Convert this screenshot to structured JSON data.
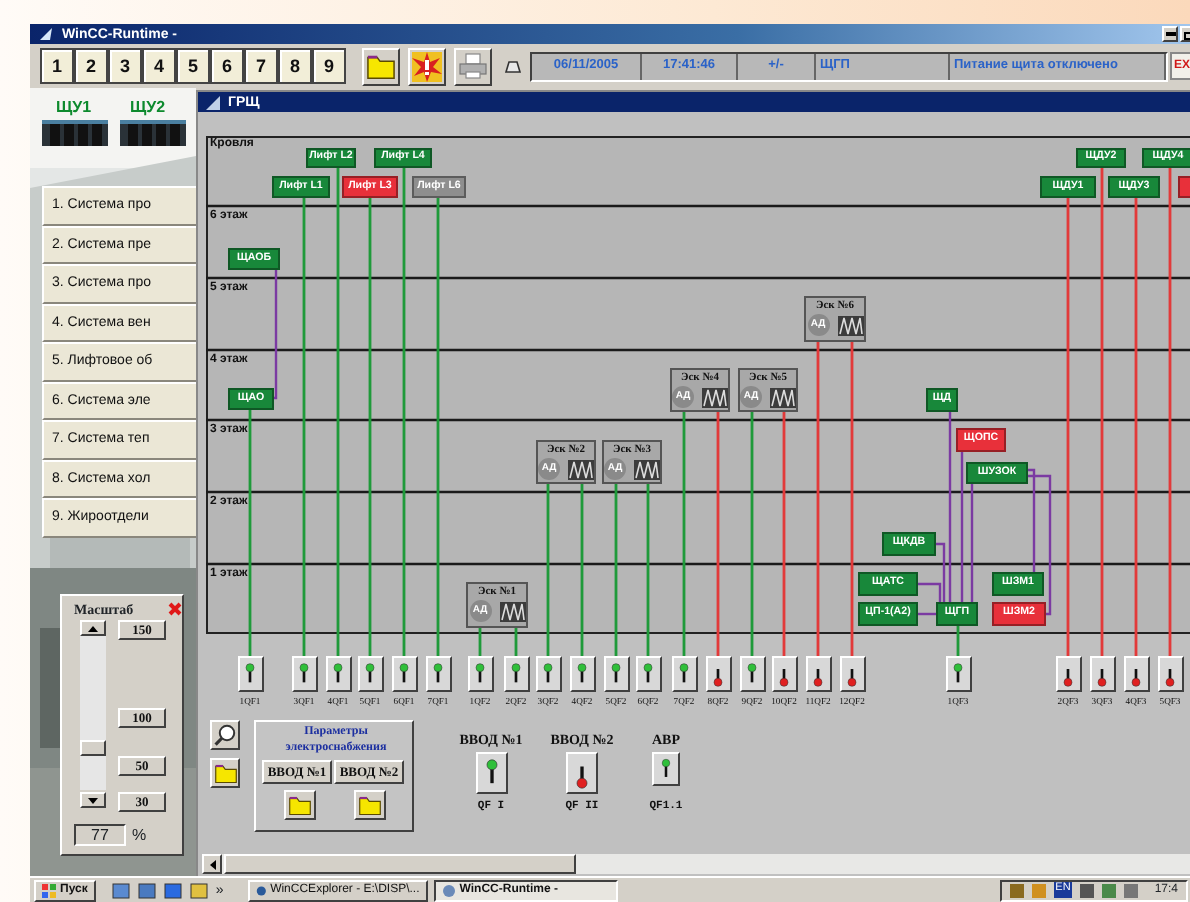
{
  "window": {
    "title": "WinCC-Runtime -"
  },
  "toolbar": {
    "screen_buttons": [
      "1",
      "2",
      "3",
      "4",
      "5",
      "6",
      "7",
      "8",
      "9"
    ],
    "date": "06/11/2005",
    "time": "17:41:46",
    "sign": "+/-",
    "panel": "ЩГП",
    "message": "Питание щита отключено",
    "exit": "EX"
  },
  "left_panel": {
    "cabinets": [
      "ЩУ1",
      "ЩУ2"
    ],
    "menu": [
      "1. Система про",
      "2. Система пре",
      "3. Система про",
      "4. Система вен",
      "5. Лифтовое об",
      "6. Система эле",
      "7. Система теп",
      "8. Система хол",
      "9. Жироотдели"
    ]
  },
  "scale_panel": {
    "title": "Масштаб",
    "presets": [
      "150",
      "100",
      "50",
      "30"
    ],
    "level": 0.25,
    "value": "77",
    "unit": "%"
  },
  "grsh_window": {
    "title": "ГРЩ",
    "floors": [
      "Кровля",
      "6 этаж",
      "5 этаж",
      "4 этаж",
      "3 этаж",
      "2 этаж",
      "1 этаж"
    ],
    "nodes": [
      {
        "kind": "panel",
        "label": "Лифт L2",
        "on": true,
        "disabled": false
      },
      {
        "kind": "panel",
        "label": "Лифт L4",
        "on": true,
        "disabled": false
      },
      {
        "kind": "panel",
        "label": "ЩДУ2",
        "on": true,
        "disabled": false
      },
      {
        "kind": "panel",
        "label": "ЩДУ4",
        "on": true,
        "disabled": false
      },
      {
        "kind": "panel",
        "label": "Лифт L1",
        "on": true,
        "disabled": false
      },
      {
        "kind": "panel",
        "label": "Лифт L3",
        "on": false,
        "disabled": false
      },
      {
        "kind": "panel",
        "label": "Лифт L6",
        "disabled": true
      },
      {
        "kind": "panel",
        "label": "ЩДУ1",
        "on": true,
        "disabled": false
      },
      {
        "kind": "panel",
        "label": "ЩДУ3",
        "on": true,
        "disabled": false
      },
      {
        "kind": "panel",
        "on": false,
        "disabled": false
      },
      {
        "kind": "panel",
        "label": "ЩАОБ",
        "on": true,
        "disabled": false
      },
      {
        "kind": "escalator",
        "label": "Эск №6",
        "motor": "АД"
      },
      {
        "kind": "panel",
        "label": "ЩАО",
        "on": true,
        "disabled": false
      },
      {
        "kind": "escalator",
        "label": "Эск №4",
        "motor": "АД"
      },
      {
        "kind": "escalator",
        "label": "Эск №5",
        "motor": "АД"
      },
      {
        "kind": "panel",
        "label": "ЩД",
        "on": true,
        "disabled": false
      },
      {
        "kind": "escalator",
        "label": "Эск №2",
        "motor": "АД"
      },
      {
        "kind": "escalator",
        "label": "Эск №3",
        "motor": "АД"
      },
      {
        "kind": "panel",
        "label": "ЩОПС",
        "on": false,
        "disabled": false
      },
      {
        "kind": "panel",
        "label": "ШУЗОК",
        "on": true,
        "disabled": false
      },
      {
        "kind": "panel",
        "label": "ЩКДВ",
        "on": true,
        "disabled": false
      },
      {
        "kind": "escalator",
        "label": "Эск №1",
        "motor": "АД"
      },
      {
        "kind": "panel",
        "label": "ЩАТС",
        "on": true,
        "disabled": false
      },
      {
        "kind": "panel",
        "label": "ЦП-1(А2)",
        "on": true,
        "disabled": false
      },
      {
        "kind": "panel",
        "label": "ЩГП",
        "on": true,
        "disabled": false
      },
      {
        "kind": "panel",
        "label": "ШЗМ1",
        "on": true,
        "disabled": false
      },
      {
        "kind": "panel",
        "label": "ШЗМ2",
        "on": false,
        "disabled": false
      }
    ],
    "breakers": [
      {
        "label": "1QF1",
        "on": true
      },
      {
        "label": "3QF1",
        "on": true
      },
      {
        "label": "4QF1",
        "on": true
      },
      {
        "label": "5QF1",
        "on": true
      },
      {
        "label": "6QF1",
        "on": true
      },
      {
        "label": "7QF1",
        "on": true
      },
      {
        "label": "1QF2",
        "on": true
      },
      {
        "label": "2QF2",
        "on": true
      },
      {
        "label": "3QF2",
        "on": true
      },
      {
        "label": "4QF2",
        "on": true
      },
      {
        "label": "5QF2",
        "on": true
      },
      {
        "label": "6QF2",
        "on": true
      },
      {
        "label": "7QF2",
        "on": true
      },
      {
        "label": "8QF2",
        "on": false
      },
      {
        "label": "9QF2",
        "on": true
      },
      {
        "label": "10QF2",
        "on": false
      },
      {
        "label": "11QF2",
        "on": false
      },
      {
        "label": "12QF2",
        "on": false
      },
      {
        "label": "1QF3",
        "on": true
      },
      {
        "label": "2QF3",
        "on": false
      },
      {
        "label": "3QF3",
        "on": false
      },
      {
        "label": "4QF3",
        "on": false
      },
      {
        "label": "5QF3",
        "on": false
      }
    ],
    "supply_params": {
      "title": "Параметры электроснабжения",
      "buttons": [
        "ВВОД №1",
        "ВВОД №2"
      ]
    },
    "inputs": [
      {
        "title": "ВВОД №1",
        "switch": "QF I",
        "on": true,
        "kind": "large"
      },
      {
        "title": "ВВОД №2",
        "switch": "QF II",
        "on": false,
        "kind": "large"
      },
      {
        "title": "АВР",
        "switch": "QF1.1",
        "on": true,
        "kind": "small"
      }
    ]
  },
  "taskbar": {
    "start": "Пуск",
    "more": "»",
    "tasks": [
      {
        "label": "WinCCExplorer - E:\\DISP\\...",
        "selected": false
      },
      {
        "label": "WinCC-Runtime -",
        "selected": true
      }
    ],
    "language": "EN",
    "clock": "17:4"
  }
}
